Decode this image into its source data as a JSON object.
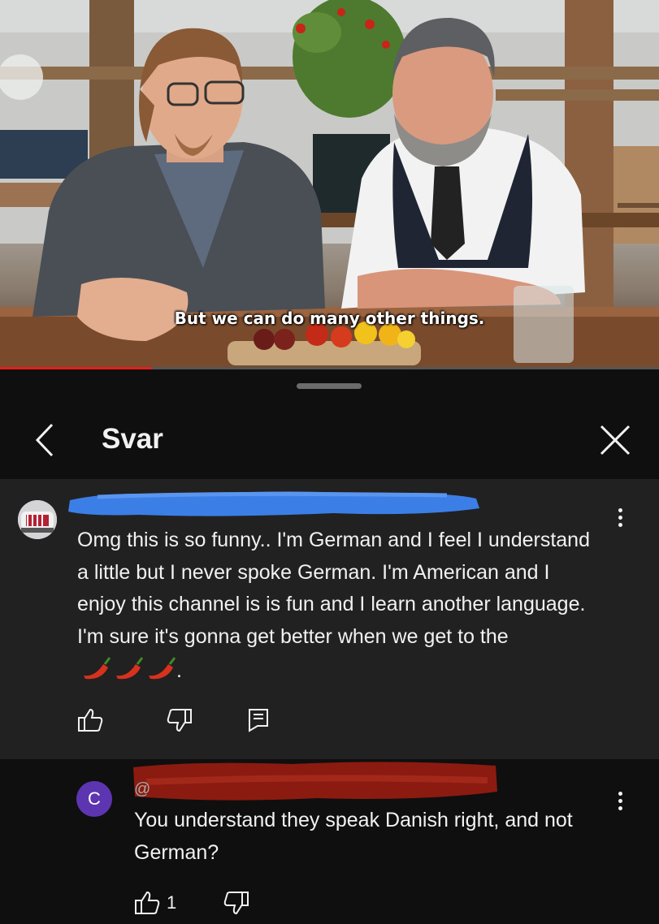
{
  "video": {
    "subtitle": "But we can do many other things.",
    "progress_fraction": 0.23
  },
  "panel": {
    "title": "Svar"
  },
  "comment": {
    "text": "Omg this is so funny.. I'm German and I feel I understand a little but I never spoke German. I'm American and I enjoy this channel is is fun and I learn another language. I'm sure it's gonna get better when we get to the",
    "trailing_emoji": "🌶🌶🌶",
    "trailing_punct": "."
  },
  "reply": {
    "avatar_letter": "C",
    "author_fragment": "@",
    "text": "You understand they speak Danish right, and not German?",
    "like_count": "1"
  },
  "colors": {
    "accent_progress": "#e32020",
    "reply_avatar": "#5e35b1",
    "redaction_blue": "#3b7fe6",
    "redaction_red": "#8b1a10"
  }
}
